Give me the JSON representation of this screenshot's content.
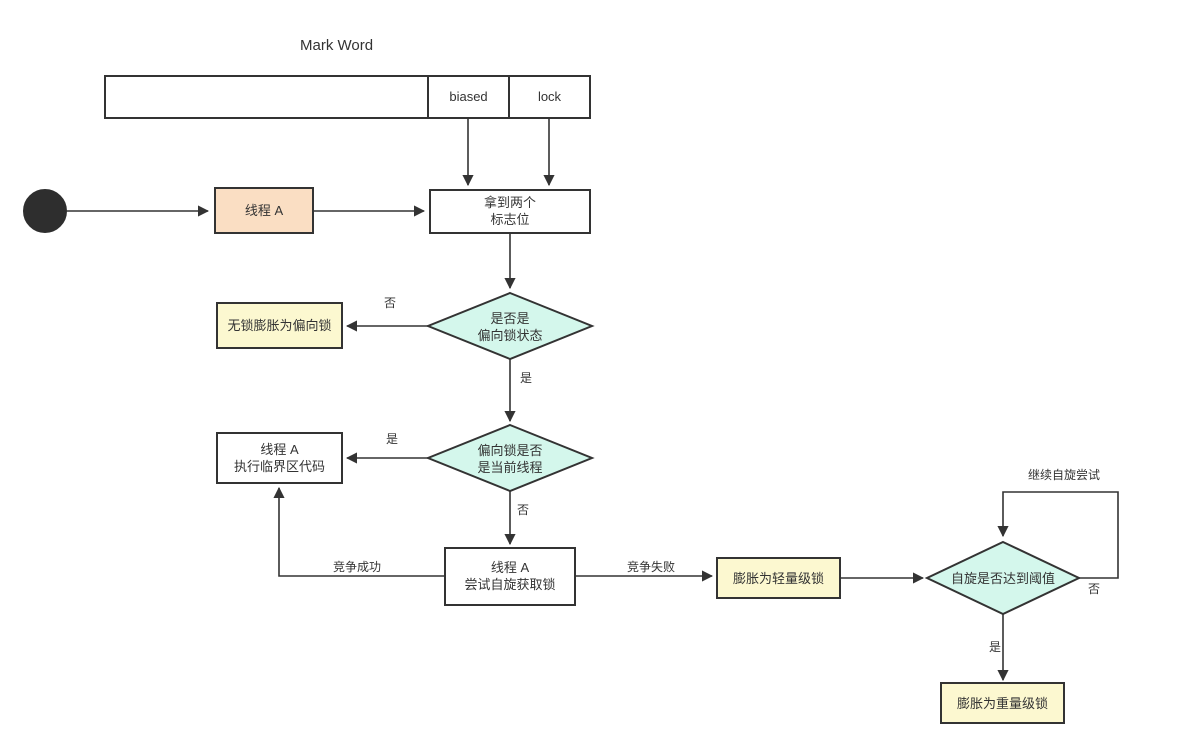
{
  "diagram": {
    "title": "Mark Word",
    "colors": {
      "stroke": "#333333",
      "yellow_fill": "#fcf8d0",
      "orange_fill": "#fadec3",
      "teal_fill": "#d4f7ec",
      "white_fill": "#ffffff",
      "start_fill": "#2e2e2e",
      "text": "#333333"
    },
    "markword_table": {
      "cells": [
        {
          "label": ""
        },
        {
          "label": "biased"
        },
        {
          "label": "lock"
        }
      ]
    },
    "nodes": [
      {
        "id": "start",
        "shape": "circle",
        "label": ""
      },
      {
        "id": "thread-a",
        "shape": "rect",
        "label": "线程 A"
      },
      {
        "id": "get-two-flags",
        "shape": "rect",
        "label_line1": "拿到两个",
        "label_line2": "标志位"
      },
      {
        "id": "is-biased-state",
        "shape": "diamond",
        "label_line1": "是否是",
        "label_line2": "偏向锁状态"
      },
      {
        "id": "inflate-to-biased",
        "shape": "rect",
        "label": "无锁膨胀为偏向锁"
      },
      {
        "id": "is-current-thread",
        "shape": "diamond",
        "label_line1": "偏向锁是否",
        "label_line2": "是当前线程"
      },
      {
        "id": "run-critical",
        "shape": "rect",
        "label_line1": "线程 A",
        "label_line2": "执行临界区代码"
      },
      {
        "id": "try-spin-lock",
        "shape": "rect",
        "label_line1": "线程 A",
        "label_line2": "尝试自旋获取锁"
      },
      {
        "id": "inflate-light",
        "shape": "rect",
        "label": "膨胀为轻量级锁"
      },
      {
        "id": "spin-threshold",
        "shape": "diamond",
        "label": "自旋是否达到阈值"
      },
      {
        "id": "inflate-heavy",
        "shape": "rect",
        "label": "膨胀为重量级锁"
      }
    ],
    "edge_labels": {
      "biased_no": "否",
      "biased_yes": "是",
      "current_thread_yes": "是",
      "current_thread_no": "否",
      "compete_success": "竞争成功",
      "compete_fail": "竞争失败",
      "threshold_no": "否",
      "threshold_yes": "是",
      "keep_spinning": "继续自旋尝试"
    }
  }
}
